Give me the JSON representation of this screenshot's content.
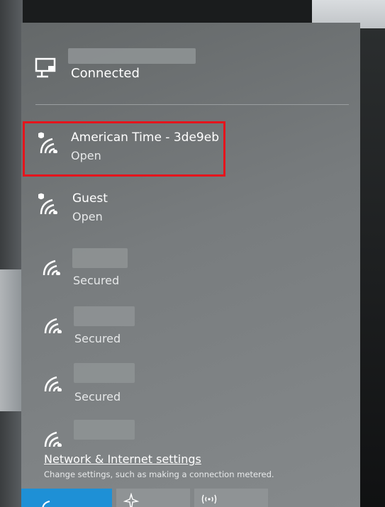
{
  "connected_network": {
    "status": "Connected"
  },
  "networks": [
    {
      "name": "American Time - 3de9eb",
      "status": "Open",
      "icon": "wifi-shield-icon"
    },
    {
      "name": "Guest",
      "status": "Open",
      "icon": "wifi-shield-icon"
    },
    {
      "name": "",
      "status": "Secured",
      "icon": "wifi-icon"
    },
    {
      "name": "",
      "status": "Secured",
      "icon": "wifi-icon"
    },
    {
      "name": "",
      "status": "Secured",
      "icon": "wifi-icon"
    },
    {
      "name": "",
      "status": "",
      "icon": "wifi-icon"
    }
  ],
  "footer": {
    "settings_link": "Network & Internet settings",
    "settings_desc": "Change settings, such as making a connection metered."
  },
  "colors": {
    "highlight": "#e5141c",
    "panel": "#787c7e",
    "quick_action_active": "#1e90d6"
  }
}
